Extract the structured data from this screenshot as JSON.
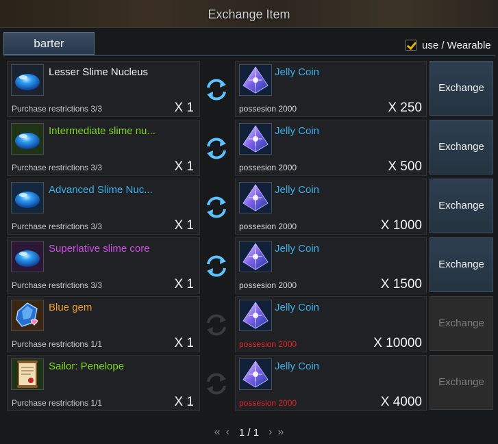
{
  "window": {
    "title": "Exchange Item"
  },
  "tabs": [
    {
      "label": "barter"
    }
  ],
  "filter": {
    "label": "use / Wearable",
    "checked": true,
    "check_color": "#e0b600"
  },
  "colors": {
    "white": "#f4f4f4",
    "green": "#7fd51c",
    "blue": "#3bb2ea",
    "purple": "#d04ee6",
    "orange": "#f19a24",
    "red": "#e2262a"
  },
  "rows": [
    {
      "name": "Lesser Slime Nucleus",
      "name_color": "white",
      "icon": "slime-nucleus-icon",
      "restriction": "Purchase restrictions 3/3",
      "give_qty": "X 1",
      "reward": "Jelly Coin",
      "reward_icon": "jelly-coin-icon",
      "possession": "possesion 2000",
      "possession_insufficient": false,
      "cost": "X 250",
      "button": "Exchange",
      "enabled": true
    },
    {
      "name": "Intermediate slime nu...",
      "name_color": "green",
      "icon": "slime-nucleus-icon",
      "restriction": "Purchase restrictions 3/3",
      "give_qty": "X 1",
      "reward": "Jelly Coin",
      "reward_icon": "jelly-coin-icon",
      "possession": "possesion 2000",
      "possession_insufficient": false,
      "cost": "X 500",
      "button": "Exchange",
      "enabled": true
    },
    {
      "name": "Advanced Slime Nuc...",
      "name_color": "blue",
      "icon": "slime-nucleus-icon",
      "restriction": "Purchase restrictions 3/3",
      "give_qty": "X 1",
      "reward": "Jelly Coin",
      "reward_icon": "jelly-coin-icon",
      "possession": "possesion 2000",
      "possession_insufficient": false,
      "cost": "X 1000",
      "button": "Exchange",
      "enabled": true
    },
    {
      "name": "Superlative slime core",
      "name_color": "purple",
      "icon": "slime-nucleus-icon",
      "restriction": "Purchase restrictions 3/3",
      "give_qty": "X 1",
      "reward": "Jelly Coin",
      "reward_icon": "jelly-coin-icon",
      "possession": "possesion 2000",
      "possession_insufficient": false,
      "cost": "X 1500",
      "button": "Exchange",
      "enabled": true
    },
    {
      "name": "Blue gem",
      "name_color": "orange",
      "icon": "blue-gem-icon",
      "restriction": "Purchase restrictions 1/1",
      "give_qty": "X 1",
      "reward": "Jelly Coin",
      "reward_icon": "jelly-coin-icon",
      "possession": "possesion 2000",
      "possession_insufficient": true,
      "cost": "X 10000",
      "button": "Exchange",
      "enabled": false
    },
    {
      "name": "Sailor: Penelope",
      "name_color": "green",
      "icon": "scroll-icon",
      "restriction": "Purchase restrictions 1/1",
      "give_qty": "X 1",
      "reward": "Jelly Coin",
      "reward_icon": "jelly-coin-icon",
      "possession": "possesion 2000",
      "possession_insufficient": true,
      "cost": "X 4000",
      "button": "Exchange",
      "enabled": false
    }
  ],
  "pagination": {
    "text": "1 / 1"
  }
}
